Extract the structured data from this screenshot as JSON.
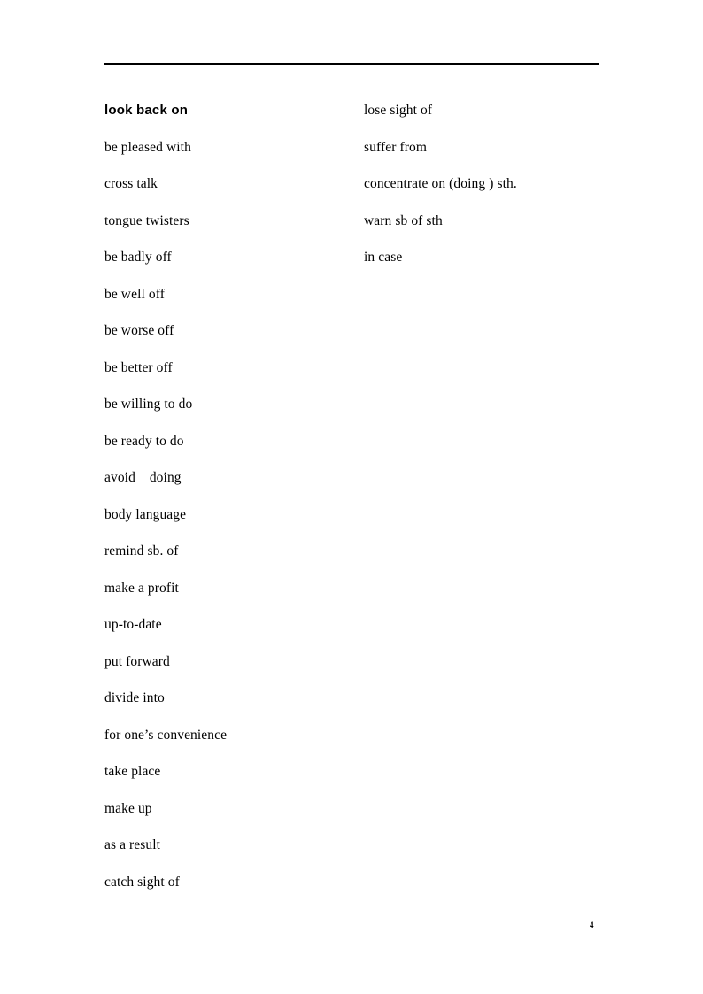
{
  "document": {
    "page_number": "4",
    "rule_color": "#000000",
    "text_color": "#000000",
    "background_color": "#ffffff"
  },
  "columns": {
    "left": {
      "entries": [
        {
          "text": "look back on",
          "style": "bold-sans"
        },
        {
          "text": "be pleased with",
          "style": "serif"
        },
        {
          "text": "cross talk",
          "style": "serif"
        },
        {
          "text": "tongue twisters",
          "style": "serif"
        },
        {
          "text": "be badly off",
          "style": "serif"
        },
        {
          "text": "be well off",
          "style": "serif"
        },
        {
          "text": "be worse off",
          "style": "serif"
        },
        {
          "text": "be better off",
          "style": "serif"
        },
        {
          "text": "be willing to do",
          "style": "serif"
        },
        {
          "text": "be ready to do",
          "style": "serif"
        },
        {
          "text": "avoid    doing",
          "style": "serif"
        },
        {
          "text": "body language",
          "style": "serif"
        },
        {
          "text": "remind sb. of",
          "style": "serif"
        },
        {
          "text": "make a profit",
          "style": "serif"
        },
        {
          "text": "up-to-date",
          "style": "serif"
        },
        {
          "text": "put forward",
          "style": "serif"
        },
        {
          "text": "divide into",
          "style": "serif"
        },
        {
          "text": "for one’s convenience",
          "style": "serif"
        },
        {
          "text": "take place",
          "style": "serif"
        },
        {
          "text": "make up",
          "style": "serif"
        },
        {
          "text": "as a result",
          "style": "serif"
        },
        {
          "text": "catch sight of",
          "style": "serif"
        }
      ]
    },
    "right": {
      "entries": [
        {
          "text": "lose sight of",
          "style": "serif"
        },
        {
          "text": "suffer from",
          "style": "serif"
        },
        {
          "text": "concentrate on (doing ) sth.",
          "style": "serif"
        },
        {
          "text": "warn sb of sth",
          "style": "serif"
        },
        {
          "text": "in case",
          "style": "serif"
        }
      ]
    }
  }
}
